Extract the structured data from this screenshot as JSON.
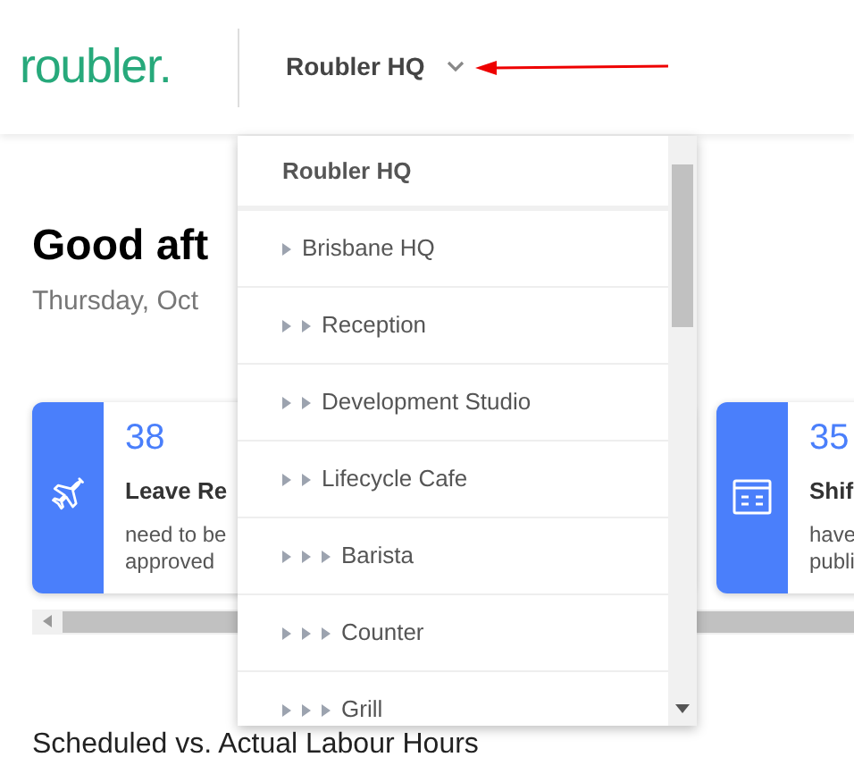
{
  "header": {
    "logo": "roubler.",
    "location": "Roubler HQ"
  },
  "greeting": {
    "title": "Good aft",
    "date": "Thursday, Oct"
  },
  "cards": [
    {
      "kind": "leave",
      "count": "38",
      "title": "Leave Re",
      "lines": [
        "need to be",
        "approved"
      ]
    },
    {
      "kind": "shifts",
      "count": "35",
      "title": "Shif",
      "lines": [
        "have",
        "publi"
      ]
    }
  ],
  "section_title": "Scheduled vs. Actual Labour Hours",
  "dropdown": {
    "heading": "Roubler HQ",
    "items": [
      {
        "label": "Brisbane HQ",
        "children": [
          {
            "label": "Reception"
          },
          {
            "label": "Development Studio"
          },
          {
            "label": "Lifecycle Cafe",
            "children": [
              {
                "label": "Barista"
              },
              {
                "label": "Counter"
              },
              {
                "label": "Grill"
              }
            ]
          }
        ]
      }
    ]
  }
}
